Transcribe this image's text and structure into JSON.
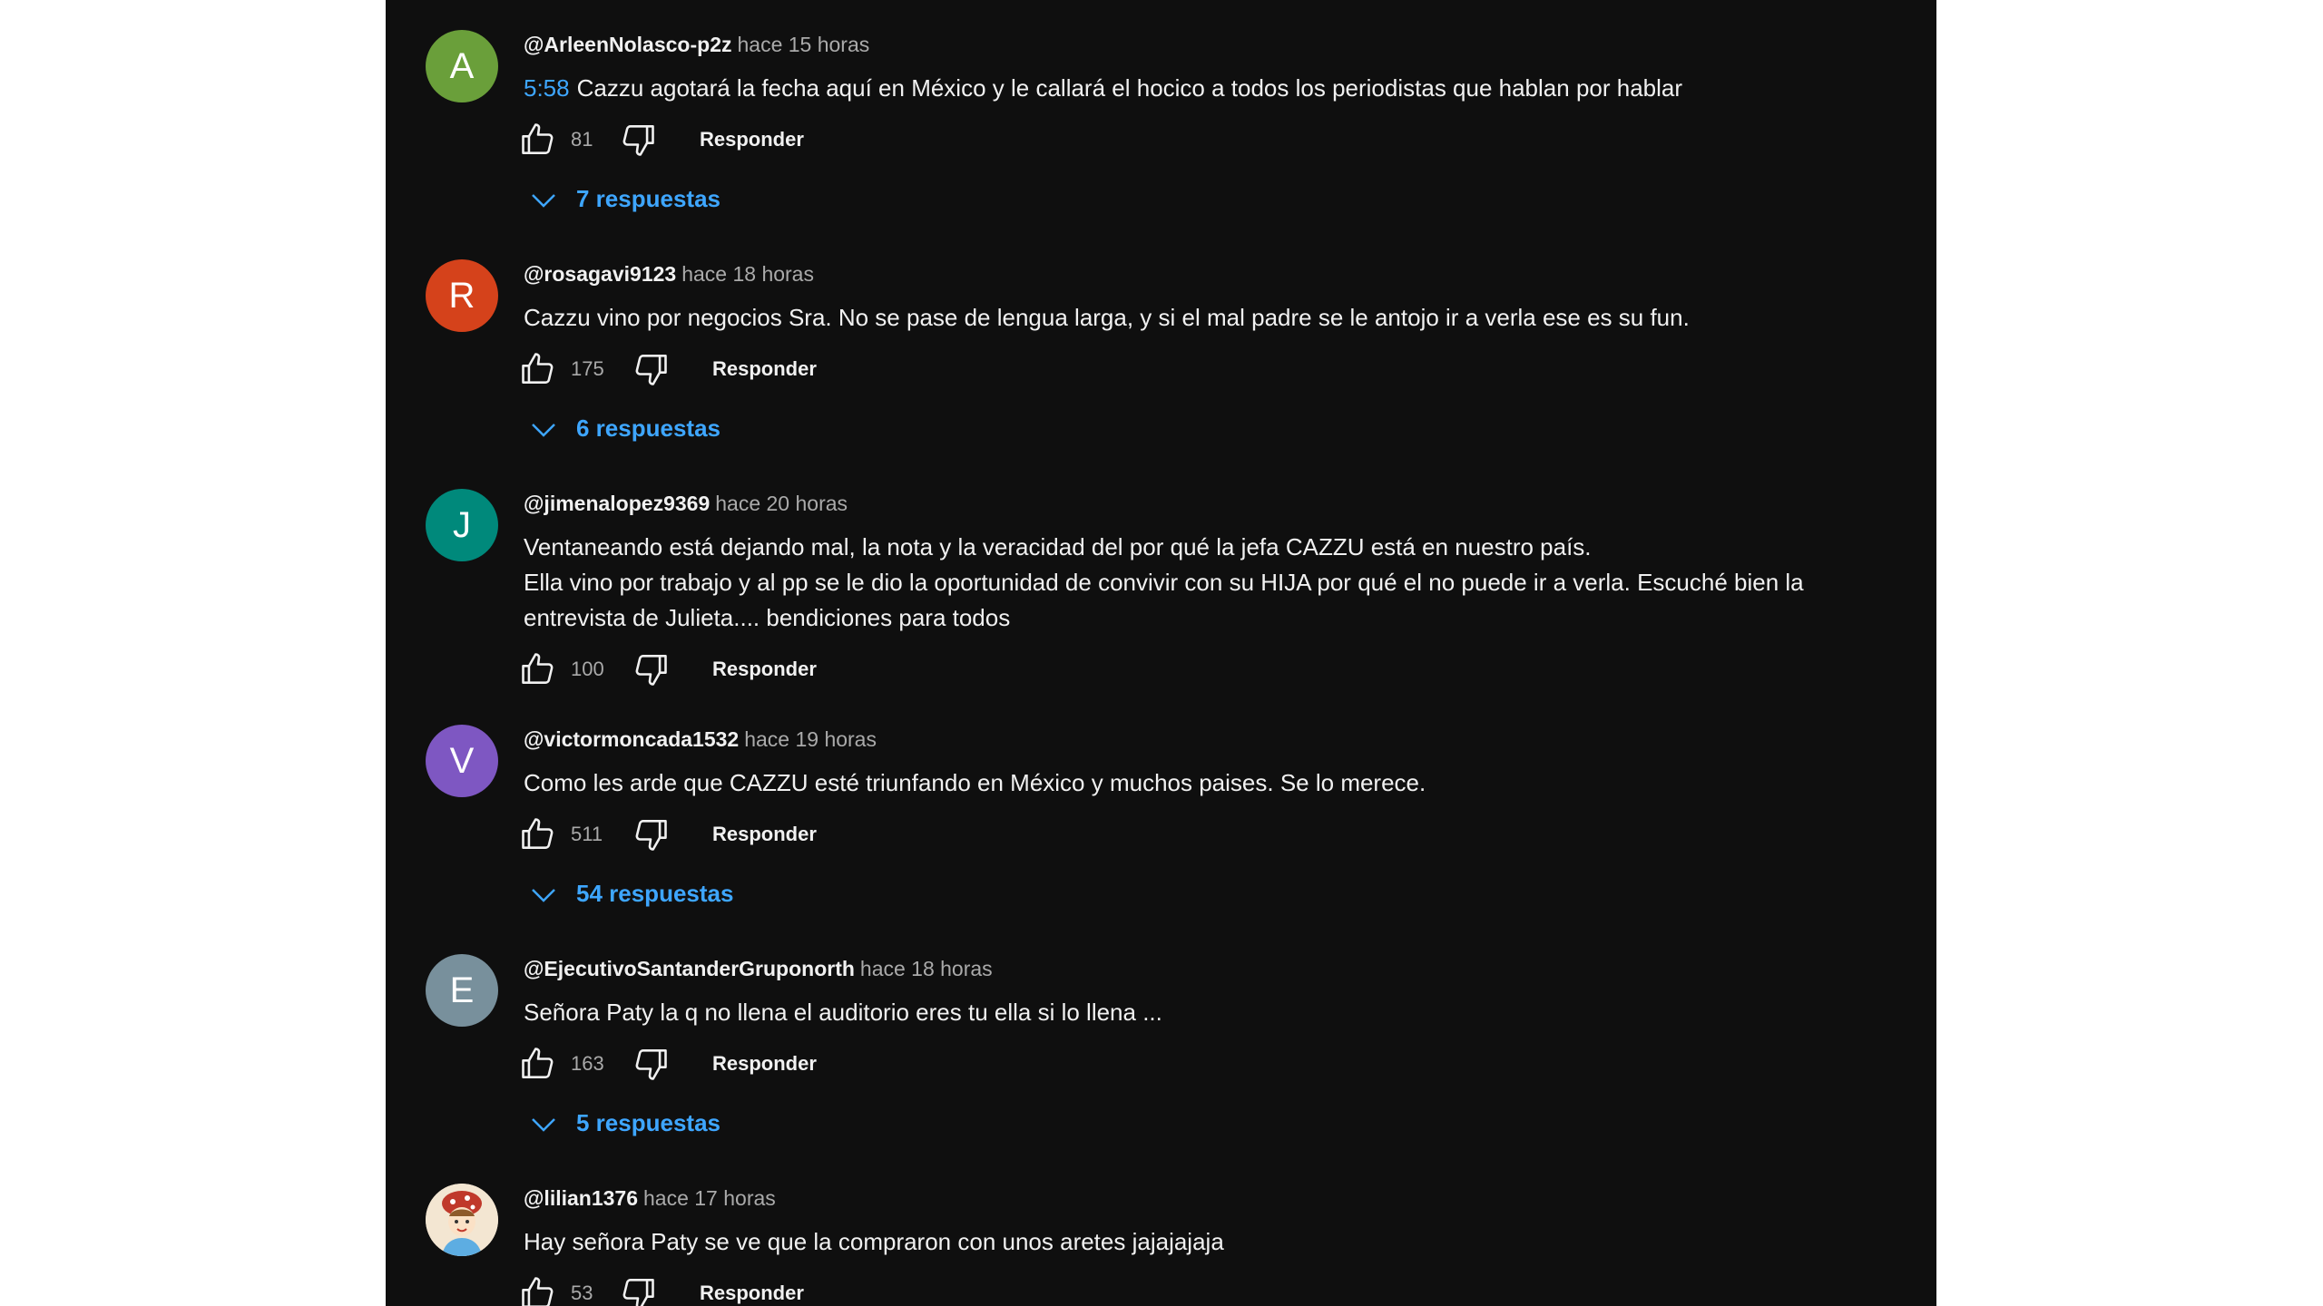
{
  "comments": [
    {
      "avatar": {
        "letter": "A",
        "color": "#6a9f3a"
      },
      "author": "@ArleenNolasco-p2z",
      "time": "hace 15 horas",
      "timestamp_link": "5:58",
      "lines": [
        "Cazzu agotará la fecha aquí en México y le callará el hocico a todos los periodistas que hablan por hablar"
      ],
      "likes": "81",
      "reply_label": "Responder",
      "replies_label": "7 respuestas"
    },
    {
      "avatar": {
        "letter": "R",
        "color": "#d5421b"
      },
      "author": "@rosagavi9123",
      "time": "hace 18 horas",
      "lines": [
        "Cazzu vino por negocios Sra. No se pase de lengua larga, y si el mal padre se le antojo ir a verla ese es su fun."
      ],
      "likes": "175",
      "reply_label": "Responder",
      "replies_label": "6 respuestas"
    },
    {
      "avatar": {
        "letter": "J",
        "color": "#00897b"
      },
      "author": "@jimenalopez9369",
      "time": "hace 20 horas",
      "lines": [
        "Ventaneando está dejando mal, la nota y la veracidad del por qué la jefa CAZZU está en nuestro país.",
        "Ella vino por trabajo y al pp se le dio la oportunidad de convivir con su HIJA por qué el no puede ir a verla. Escuché bien la",
        "entrevista de Julieta.... bendiciones para todos"
      ],
      "likes": "100",
      "reply_label": "Responder"
    },
    {
      "avatar": {
        "letter": "V",
        "color": "#7e57c2"
      },
      "author": "@victormoncada1532",
      "time": "hace 19 horas",
      "lines": [
        "Como les arde que CAZZU esté triunfando en México y muchos paises. Se lo merece."
      ],
      "likes": "511",
      "reply_label": "Responder",
      "replies_label": "54 respuestas"
    },
    {
      "avatar": {
        "letter": "E",
        "color": "#78909c"
      },
      "author": "@EjecutivoSantanderGruponorth",
      "time": "hace 18 horas",
      "lines": [
        "Señora Paty la q no llena el auditorio eres tu ella si lo llena ..."
      ],
      "likes": "163",
      "reply_label": "Responder",
      "replies_label": "5 respuestas"
    },
    {
      "avatar": {
        "letter": "",
        "color": "#f3e6d2",
        "type": "image"
      },
      "author": "@lilian1376",
      "time": "hace 17 horas",
      "lines": [
        "Hay señora Paty se ve que la compraron con unos aretes jajajajaja"
      ],
      "likes": "53",
      "reply_label": "Responder"
    }
  ],
  "icons": {
    "like": "thumb-up-icon",
    "dislike": "thumb-down-icon",
    "expand": "chevron-down-icon"
  }
}
